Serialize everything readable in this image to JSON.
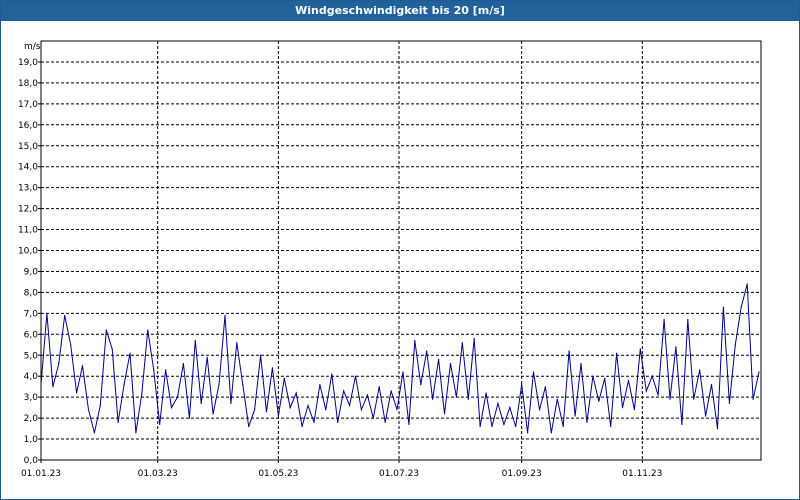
{
  "window": {
    "title": "Windgeschwindigkeit bis 20 [m/s]"
  },
  "colors": {
    "titlebar": "#21629a",
    "series": "#00008b",
    "grid": "#000000"
  },
  "chart_data": {
    "type": "line",
    "title": "Windgeschwindigkeit bis 20 [m/s]",
    "ylabel": "m/s",
    "xlabel": "",
    "ylim": [
      0,
      20
    ],
    "xlim": [
      "2023-01-01",
      "2023-12-31"
    ],
    "grid": true,
    "legend": "none",
    "y_ticks": [
      "0,0",
      "1,0",
      "2,0",
      "3,0",
      "4,0",
      "5,0",
      "6,0",
      "7,0",
      "8,0",
      "9,0",
      "10,0",
      "11,0",
      "12,0",
      "13,0",
      "14,0",
      "15,0",
      "16,0",
      "17,0",
      "18,0",
      "19,0"
    ],
    "x_ticks": [
      {
        "date": "2023-01-01",
        "label": "01.01.23"
      },
      {
        "date": "2023-03-01",
        "label": "01.03.23"
      },
      {
        "date": "2023-05-01",
        "label": "01.05.23"
      },
      {
        "date": "2023-07-01",
        "label": "01.07.23"
      },
      {
        "date": "2023-09-01",
        "label": "01.09.23"
      },
      {
        "date": "2023-11-01",
        "label": "01.11.23"
      }
    ],
    "series": [
      {
        "x": [
          "2023-01-01",
          "2023-01-04",
          "2023-01-07",
          "2023-01-10",
          "2023-01-13",
          "2023-01-16",
          "2023-01-19",
          "2023-01-22",
          "2023-01-25",
          "2023-01-28",
          "2023-01-31",
          "2023-02-03",
          "2023-02-06",
          "2023-02-09",
          "2023-02-12",
          "2023-02-15",
          "2023-02-18",
          "2023-02-21",
          "2023-02-24",
          "2023-02-27",
          "2023-03-02",
          "2023-03-05",
          "2023-03-08",
          "2023-03-11",
          "2023-03-14",
          "2023-03-17",
          "2023-03-20",
          "2023-03-23",
          "2023-03-26",
          "2023-03-29",
          "2023-04-01",
          "2023-04-04",
          "2023-04-07",
          "2023-04-10",
          "2023-04-13",
          "2023-04-16",
          "2023-04-19",
          "2023-04-22",
          "2023-04-25",
          "2023-04-28",
          "2023-05-01",
          "2023-05-04",
          "2023-05-07",
          "2023-05-10",
          "2023-05-13",
          "2023-05-16",
          "2023-05-19",
          "2023-05-22",
          "2023-05-25",
          "2023-05-28",
          "2023-05-31",
          "2023-06-03",
          "2023-06-06",
          "2023-06-09",
          "2023-06-12",
          "2023-06-15",
          "2023-06-18",
          "2023-06-21",
          "2023-06-24",
          "2023-06-27",
          "2023-06-30",
          "2023-07-03",
          "2023-07-06",
          "2023-07-09",
          "2023-07-12",
          "2023-07-15",
          "2023-07-18",
          "2023-07-21",
          "2023-07-24",
          "2023-07-27",
          "2023-07-30",
          "2023-08-02",
          "2023-08-05",
          "2023-08-08",
          "2023-08-11",
          "2023-08-14",
          "2023-08-17",
          "2023-08-20",
          "2023-08-23",
          "2023-08-26",
          "2023-08-29",
          "2023-09-01",
          "2023-09-04",
          "2023-09-07",
          "2023-09-10",
          "2023-09-13",
          "2023-09-16",
          "2023-09-19",
          "2023-09-22",
          "2023-09-25",
          "2023-09-28",
          "2023-10-01",
          "2023-10-04",
          "2023-10-07",
          "2023-10-10",
          "2023-10-13",
          "2023-10-16",
          "2023-10-19",
          "2023-10-22",
          "2023-10-25",
          "2023-10-28",
          "2023-10-31",
          "2023-11-03",
          "2023-11-06",
          "2023-11-09",
          "2023-11-12",
          "2023-11-15",
          "2023-11-18",
          "2023-11-21",
          "2023-11-24",
          "2023-11-27",
          "2023-11-30",
          "2023-12-03",
          "2023-12-06",
          "2023-12-09",
          "2023-12-12",
          "2023-12-15",
          "2023-12-18",
          "2023-12-21",
          "2023-12-24",
          "2023-12-27",
          "2023-12-30"
        ],
        "values": [
          3.6,
          7.0,
          3.5,
          4.6,
          6.9,
          5.5,
          3.2,
          4.5,
          2.4,
          1.3,
          2.6,
          6.2,
          5.3,
          1.8,
          3.6,
          5.1,
          1.3,
          3.2,
          6.2,
          4.3,
          1.7,
          4.3,
          2.5,
          3.0,
          4.6,
          2.0,
          5.7,
          2.7,
          4.9,
          2.2,
          3.6,
          6.9,
          2.7,
          5.6,
          3.6,
          1.6,
          2.4,
          5.0,
          2.3,
          4.4,
          2.1,
          3.9,
          2.5,
          3.2,
          1.6,
          2.6,
          1.8,
          3.6,
          2.4,
          4.1,
          1.8,
          3.3,
          2.6,
          4.0,
          2.4,
          3.1,
          2.0,
          3.5,
          1.8,
          3.3,
          2.4,
          4.2,
          1.7,
          5.7,
          3.6,
          5.2,
          2.9,
          4.8,
          2.2,
          4.6,
          3.0,
          5.6,
          2.9,
          5.8,
          1.6,
          3.2,
          1.6,
          2.7,
          1.7,
          2.5,
          1.6,
          3.6,
          1.3,
          4.2,
          2.4,
          3.5,
          1.3,
          2.9,
          1.6,
          5.2,
          2.1,
          4.6,
          1.8,
          4.0,
          2.8,
          3.9,
          1.6,
          5.1,
          2.5,
          3.8,
          2.4,
          5.3,
          3.3,
          4.0,
          3.1,
          6.7,
          2.9,
          5.4,
          1.7,
          6.7,
          2.9,
          4.3,
          2.1,
          3.6,
          1.5,
          7.3,
          2.7,
          5.5,
          7.3,
          8.4,
          2.9,
          4.2
        ]
      }
    ]
  }
}
